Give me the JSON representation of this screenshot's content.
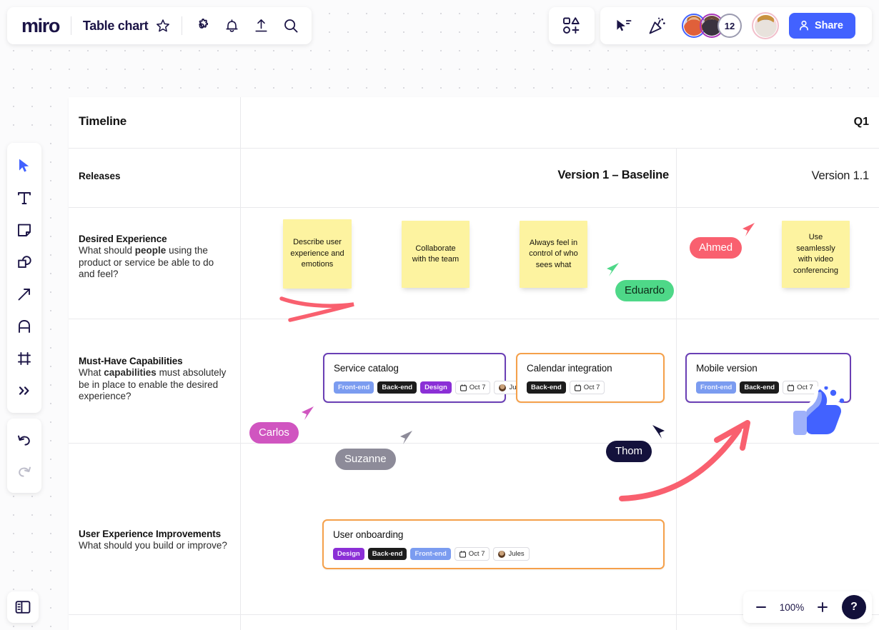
{
  "app": {
    "logo": "miro",
    "board_title": "Table chart",
    "share_label": "Share",
    "collaborator_count": "12"
  },
  "topbar": {
    "icons": [
      {
        "name": "star-icon",
        "label": "Favorite"
      },
      {
        "name": "gear-icon",
        "label": "Settings"
      },
      {
        "name": "bell-icon",
        "label": "Notifications"
      },
      {
        "name": "upload-icon",
        "label": "Export"
      },
      {
        "name": "search-icon",
        "label": "Search"
      }
    ],
    "apps_icon": "apps-grid-icon",
    "cursor_icon": "cursor-select-icon",
    "celebrate_icon": "party-popper-icon"
  },
  "left_toolbar": {
    "tools": [
      {
        "name": "select-tool",
        "label": "Select"
      },
      {
        "name": "text-tool",
        "label": "Text"
      },
      {
        "name": "sticky-note-tool",
        "label": "Sticky note"
      },
      {
        "name": "shapes-tool",
        "label": "Shapes"
      },
      {
        "name": "arrow-tool",
        "label": "Connection line"
      },
      {
        "name": "pen-tool",
        "label": "Pen"
      },
      {
        "name": "frame-tool",
        "label": "Frame"
      },
      {
        "name": "more-tools",
        "label": "More"
      }
    ],
    "undo_label": "Undo",
    "redo_label": "Redo",
    "panel_toggle_label": "Toggle panel"
  },
  "zoom_controls": {
    "minus_label": "Zoom out",
    "level": "100%",
    "plus_label": "Zoom in",
    "help_label": "?"
  },
  "table": {
    "header": {
      "title": "Timeline",
      "quarter": "Q1"
    },
    "releases_row": {
      "label": "Releases",
      "version_1": "Version 1 – Baseline",
      "version_11": "Version 1.1"
    },
    "rows": [
      {
        "title": "Desired Experience",
        "question_pre": "What should ",
        "question_bold": "people",
        "question_post": " using the product or service be able to do and feel?"
      },
      {
        "title": "Must-Have Capabilities",
        "question_pre": "What ",
        "question_bold": "capabilities",
        "question_post": " must absolutely be in place to enable the desired experience?"
      },
      {
        "title": "User Experience Improvements",
        "question_pre": "What should you build or improve?",
        "question_bold": "",
        "question_post": ""
      }
    ]
  },
  "stickies": [
    {
      "text": "Describe  user experience and emotions",
      "color": "#fdf3a0"
    },
    {
      "text": "Collaborate with the team",
      "color": "#fdf3a0"
    },
    {
      "text": "Always feel in control of who sees what",
      "color": "#fdf3a0"
    },
    {
      "text": "Use seamlessly with video conferencing",
      "color": "#fdf3a0"
    }
  ],
  "cards": [
    {
      "title": "Service catalog",
      "accent": "#6a3fb5",
      "chips": [
        {
          "label": "Front-end",
          "kind": "frontend"
        },
        {
          "label": "Back-end",
          "kind": "backend"
        },
        {
          "label": "Design",
          "kind": "design"
        }
      ],
      "date": "Oct 7",
      "assignee": "Jules"
    },
    {
      "title": "Calendar integration",
      "accent": "#f5a04a",
      "chips": [
        {
          "label": "Back-end",
          "kind": "backend"
        }
      ],
      "date": "Oct 7",
      "assignee": ""
    },
    {
      "title": "Mobile version",
      "accent": "#6a3fb5",
      "chips": [
        {
          "label": "Front-end",
          "kind": "frontend"
        },
        {
          "label": "Back-end",
          "kind": "backend"
        }
      ],
      "date": "Oct 7",
      "assignee": ""
    },
    {
      "title": "User onboarding",
      "accent": "#f5a04a",
      "chips": [
        {
          "label": "Design",
          "kind": "design"
        },
        {
          "label": "Back-end",
          "kind": "backend"
        },
        {
          "label": "Front-end",
          "kind": "frontend"
        }
      ],
      "date": "Oct 7",
      "assignee": "Jules"
    }
  ],
  "cursors": [
    {
      "name": "Eduardo",
      "color": "#4ed888",
      "text_color": "#0e2a18"
    },
    {
      "name": "Ahmed",
      "color": "#f9606f",
      "text_color": "#ffffff"
    },
    {
      "name": "Carlos",
      "color": "#d055c0",
      "text_color": "#ffffff"
    },
    {
      "name": "Suzanne",
      "color": "#8d8b99",
      "text_color": "#ffffff"
    },
    {
      "name": "Thom",
      "color": "#14123c",
      "text_color": "#ffffff"
    }
  ],
  "stickers": [
    {
      "name": "thumbs-up-sticker",
      "color": "#4262ff"
    }
  ],
  "annotations": [
    {
      "name": "red-scribble-underline",
      "color": "#f9606f"
    },
    {
      "name": "red-curved-arrow",
      "color": "#f9606f"
    }
  ]
}
